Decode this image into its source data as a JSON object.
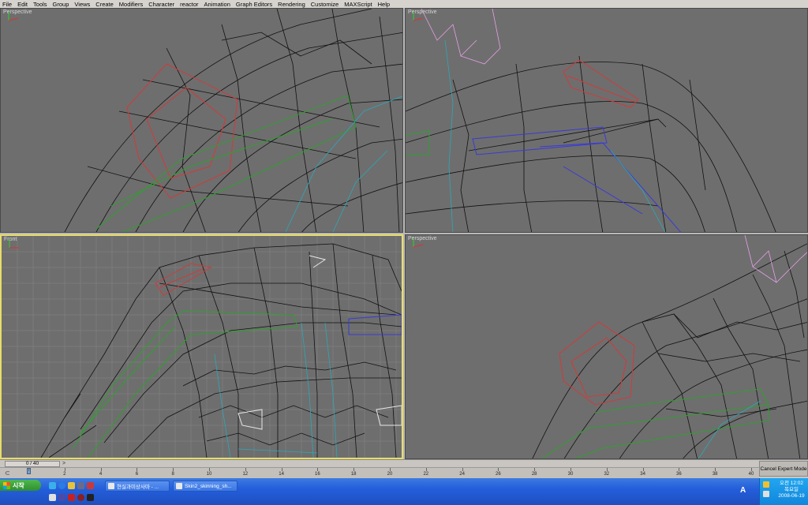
{
  "menu": [
    "File",
    "Edit",
    "Tools",
    "Group",
    "Views",
    "Create",
    "Modifiers",
    "Character",
    "reactor",
    "Animation",
    "Graph Editors",
    "Rendering",
    "Customize",
    "MAXScript",
    "Help"
  ],
  "viewports": {
    "top_left": {
      "label": "Perspective"
    },
    "top_right": {
      "label": "Perspective"
    },
    "bottom_left": {
      "label": "Front"
    },
    "bottom_right": {
      "label": "Perspective"
    }
  },
  "colors": {
    "viewport_bg": "#6e6e6e",
    "active_border": "#e8dc6a",
    "mesh": "#111111",
    "bone_red": "#d23a3a",
    "bone_green": "#2fa02f",
    "bone_cyan": "#2aa9b8",
    "bone_blue": "#3a3ad8",
    "bone_pink": "#e6a0e6"
  },
  "timeslider": {
    "frame_display": "0 / 40",
    "next_arrow": ">"
  },
  "cancel_expert_label": "Cancel Expert Mode",
  "trackbar": {
    "ticks": [
      "0",
      "2",
      "4",
      "6",
      "8",
      "10",
      "12",
      "14",
      "16",
      "18",
      "20",
      "22",
      "24",
      "26",
      "28",
      "30",
      "32",
      "34",
      "36",
      "38",
      "40"
    ]
  },
  "taskbar": {
    "start_label": "시작",
    "tasks": [
      {
        "label": "현실과미상사마 - ..."
      },
      {
        "label": "Skin2_skinning_sh..."
      }
    ],
    "ime": "A",
    "clock": {
      "time": "오전 12:02",
      "day": "목요일",
      "date": "2008-06-19"
    }
  }
}
